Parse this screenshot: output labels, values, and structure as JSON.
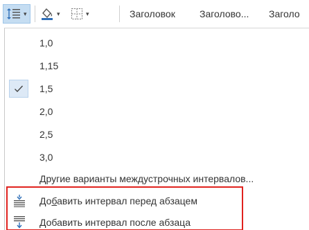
{
  "ribbon": {
    "styles": [
      "Заголовок",
      "Заголово...",
      "Заголо"
    ]
  },
  "menu": {
    "spacing_options": [
      "1,0",
      "1,15",
      "1,5",
      "2,0",
      "2,5",
      "3,0"
    ],
    "selected": "1,5",
    "more_options_label": "Другие варианты междустрочных интервалов...",
    "add_before": {
      "pre": "До",
      "accel": "б",
      "post": "авить интервал перед абзацем"
    },
    "add_after": {
      "label": "Добавить интервал после абзаца"
    }
  },
  "colors": {
    "highlight_border": "#e0221e",
    "selected_bg": "#dde9f6",
    "button_active_bg": "#c5ddf2",
    "icon_blue": "#2f6fb8"
  }
}
